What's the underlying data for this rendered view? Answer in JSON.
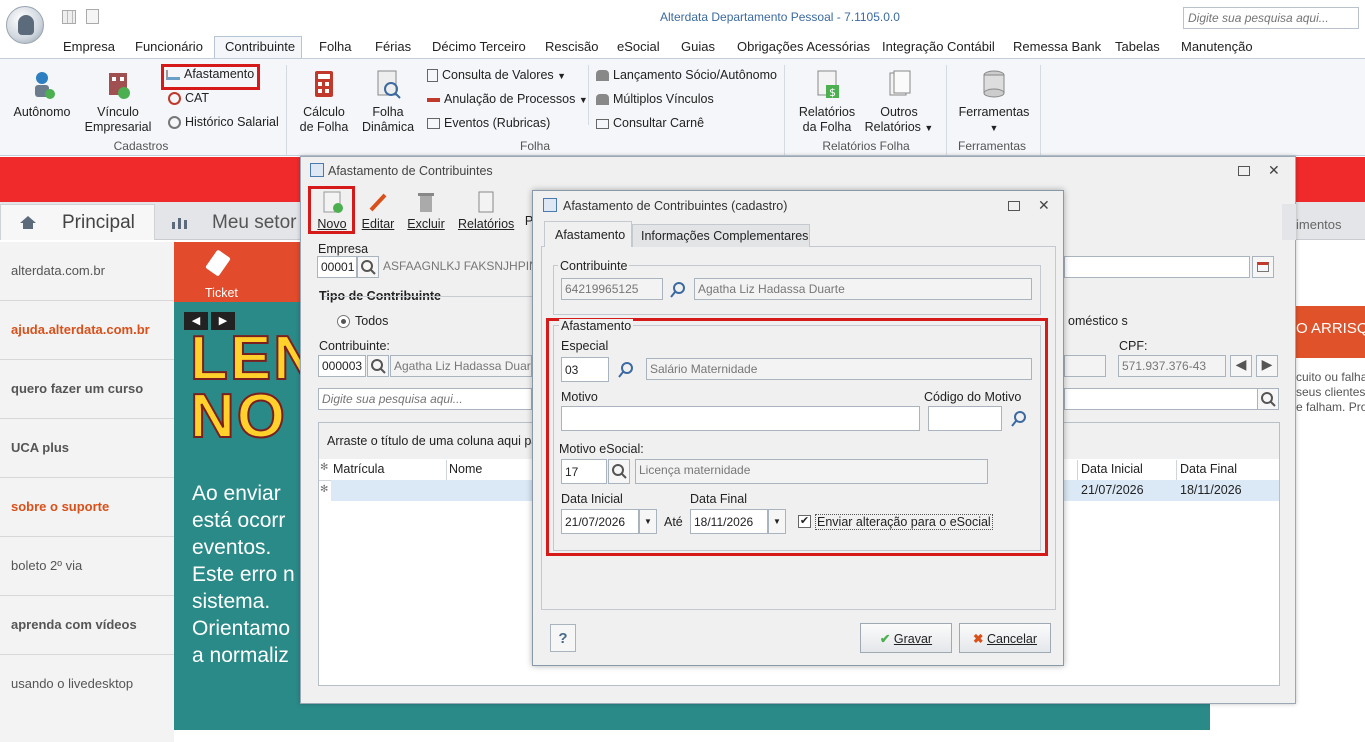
{
  "app": {
    "title": "Alterdata Departamento Pessoal - 7.1105.0.0",
    "search_placeholder": "Digite sua pesquisa aqui..."
  },
  "menu_tabs": [
    "Empresa",
    "Funcionário",
    "Contribuinte",
    "Folha",
    "Férias",
    "Décimo Terceiro",
    "Rescisão",
    "eSocial",
    "Guias",
    "Obrigações Acessórias",
    "Integração Contábil",
    "Remessa Bank",
    "Tabelas",
    "Manutenção"
  ],
  "ribbon": {
    "cadastros": {
      "label": "Cadastros",
      "autonomo": "Autônomo",
      "vinculo1": "Vínculo",
      "vinculo2": "Empresarial",
      "afastamento": "Afastamento",
      "cat": "CAT",
      "historico": "Histórico Salarial"
    },
    "folha": {
      "label": "Folha",
      "calculo1": "Cálculo",
      "calculo2": "de Folha",
      "dinamica1": "Folha",
      "dinamica2": "Dinâmica",
      "consulta": "Consulta de Valores",
      "anulacao": "Anulação de Processos",
      "eventos": "Eventos (Rubricas)",
      "lancamento": "Lançamento Sócio/Autônomo",
      "multiplos": "Múltiplos Vínculos",
      "carne": "Consultar Carnê"
    },
    "relatorios": {
      "label": "Relatórios Folha",
      "rel1": "Relatórios",
      "rel2": "da Folha",
      "outros1": "Outros",
      "outros2": "Relatórios"
    },
    "ferramentas": {
      "label": "Ferramentas",
      "btn": "Ferramentas"
    }
  },
  "page_tabs": {
    "principal": "Principal",
    "meu_setor": "Meu setor"
  },
  "sidebar_links": [
    "alterdata.com.br",
    "ajuda.alterdata.com.br",
    "quero fazer um curso",
    "UCA plus",
    "sobre o suporte",
    "boleto 2º via",
    "aprenda com vídeos",
    "usando o livedesktop"
  ],
  "banner": {
    "ticket": "Ticket",
    "big1": "LEN",
    "big2": "NO",
    "lines": [
      "Ao enviar",
      "está ocorr",
      "eventos.",
      "Este erro n",
      "sistema.",
      "Orientamo",
      "a normaliz"
    ],
    "right_title": "O ARRISQU",
    "right_lines": [
      "cuito ou falha",
      "seus clientes",
      "e falham. Prot"
    ]
  },
  "outer_dialog": {
    "title": "Afastamento de Contribuintes",
    "toolbar": {
      "novo": "Novo",
      "editar": "Editar",
      "excluir": "Excluir",
      "relatorios": "Relatórios",
      "p": "P"
    },
    "empresa_label": "Empresa",
    "empresa_code": "00001",
    "empresa_name": "ASFAAGNLKJ FAKSNJHPIN",
    "tipo_label": "Tipo de Contribuinte",
    "todos": "Todos",
    "domesticos": "oméstico s",
    "contribuinte_label": "Contribuinte:",
    "contribuinte_code": "000003",
    "contribuinte_name": "Agatha Liz Hadassa Duarte",
    "cpf_label": "CPF:",
    "cpf_value": "571.937.376-43",
    "search_placeholder": "Digite sua pesquisa aqui...",
    "group_hint": "Arraste o título de uma coluna aqui par",
    "tab_right": "imentos",
    "columns": {
      "matricula": "Matrícula",
      "nome": "Nome",
      "data_inicial": "Data Inicial",
      "data_final": "Data Final"
    },
    "row": {
      "data_inicial": "21/07/2026",
      "data_final": "18/11/2026"
    }
  },
  "inner_dialog": {
    "title": "Afastamento de Contribuintes (cadastro)",
    "tab_afastamento": "Afastamento",
    "tab_info": "Informações Complementares",
    "contribuinte_legend": "Contribuinte",
    "contribuinte_cpf": "64219965125",
    "contribuinte_name": "Agatha Liz Hadassa Duarte",
    "afastamento_legend": "Afastamento",
    "especial_label": "Especial",
    "especial_code": "03",
    "especial_desc": "Salário Maternidade",
    "motivo_label": "Motivo",
    "motivo_value": "",
    "codigo_motivo_label": "Código do Motivo",
    "codigo_motivo_value": "",
    "motivo_esocial_label": "Motivo eSocial:",
    "motivo_esocial_code": "17",
    "motivo_esocial_desc": "Licença maternidade",
    "data_inicial_label": "Data Inicial",
    "data_inicial": "21/07/2026",
    "ate": "Até",
    "data_final_label": "Data Final",
    "data_final": "18/11/2026",
    "enviar_label": "Enviar alteração para o eSocial",
    "enviar_checked": true,
    "help": "?",
    "gravar": "Gravar",
    "cancelar": "Cancelar"
  },
  "colors": {
    "accent": "#3c6aa0",
    "highlight": "#d61a1a",
    "red_strip": "#f02a2a",
    "link_orange": "#d9501a"
  }
}
